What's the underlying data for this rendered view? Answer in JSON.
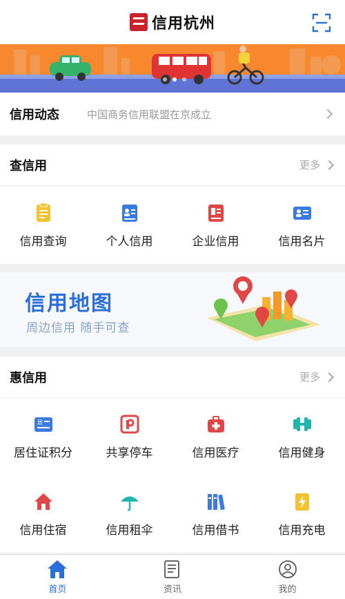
{
  "header": {
    "title": "信用杭州"
  },
  "banner": {
    "slides": 3,
    "active_slide": 2
  },
  "news": {
    "title": "信用动态",
    "text": "中国商务信用联盟在京成立"
  },
  "check_section": {
    "title": "查信用",
    "more": "更多",
    "items": [
      {
        "label": "信用查询",
        "icon": "document-icon",
        "color": "#f2c230"
      },
      {
        "label": "个人信用",
        "icon": "person-card-icon",
        "color": "#3b7be0"
      },
      {
        "label": "企业信用",
        "icon": "company-card-icon",
        "color": "#e04848"
      },
      {
        "label": "信用名片",
        "icon": "business-card-icon",
        "color": "#3b7be0"
      }
    ]
  },
  "map_card": {
    "title": "信用地图",
    "subtitle": "周边信用  随手可查"
  },
  "benefit_section": {
    "title": "惠信用",
    "more": "更多",
    "items": [
      {
        "label": "居住证积分",
        "icon": "residence-card-icon",
        "color": "#3b7be0"
      },
      {
        "label": "共享停车",
        "icon": "parking-icon",
        "color": "#e04848"
      },
      {
        "label": "信用医疗",
        "icon": "medical-kit-icon",
        "color": "#e04848"
      },
      {
        "label": "信用健身",
        "icon": "dumbbell-icon",
        "color": "#1fb5b0"
      },
      {
        "label": "信用住宿",
        "icon": "house-icon",
        "color": "#e04848"
      },
      {
        "label": "信用租伞",
        "icon": "umbrella-icon",
        "color": "#1fb5b0"
      },
      {
        "label": "信用借书",
        "icon": "books-icon",
        "color": "#3b7be0"
      },
      {
        "label": "信用充电",
        "icon": "charging-icon",
        "color": "#f2c230"
      }
    ]
  },
  "tabs": [
    {
      "label": "首页",
      "icon": "home-icon",
      "active": true
    },
    {
      "label": "资讯",
      "icon": "news-icon",
      "active": false
    },
    {
      "label": "我的",
      "icon": "profile-icon",
      "active": false
    }
  ],
  "colors": {
    "accent": "#2a6fd8",
    "brand": "#c8232b",
    "banner": "#f7882d"
  }
}
